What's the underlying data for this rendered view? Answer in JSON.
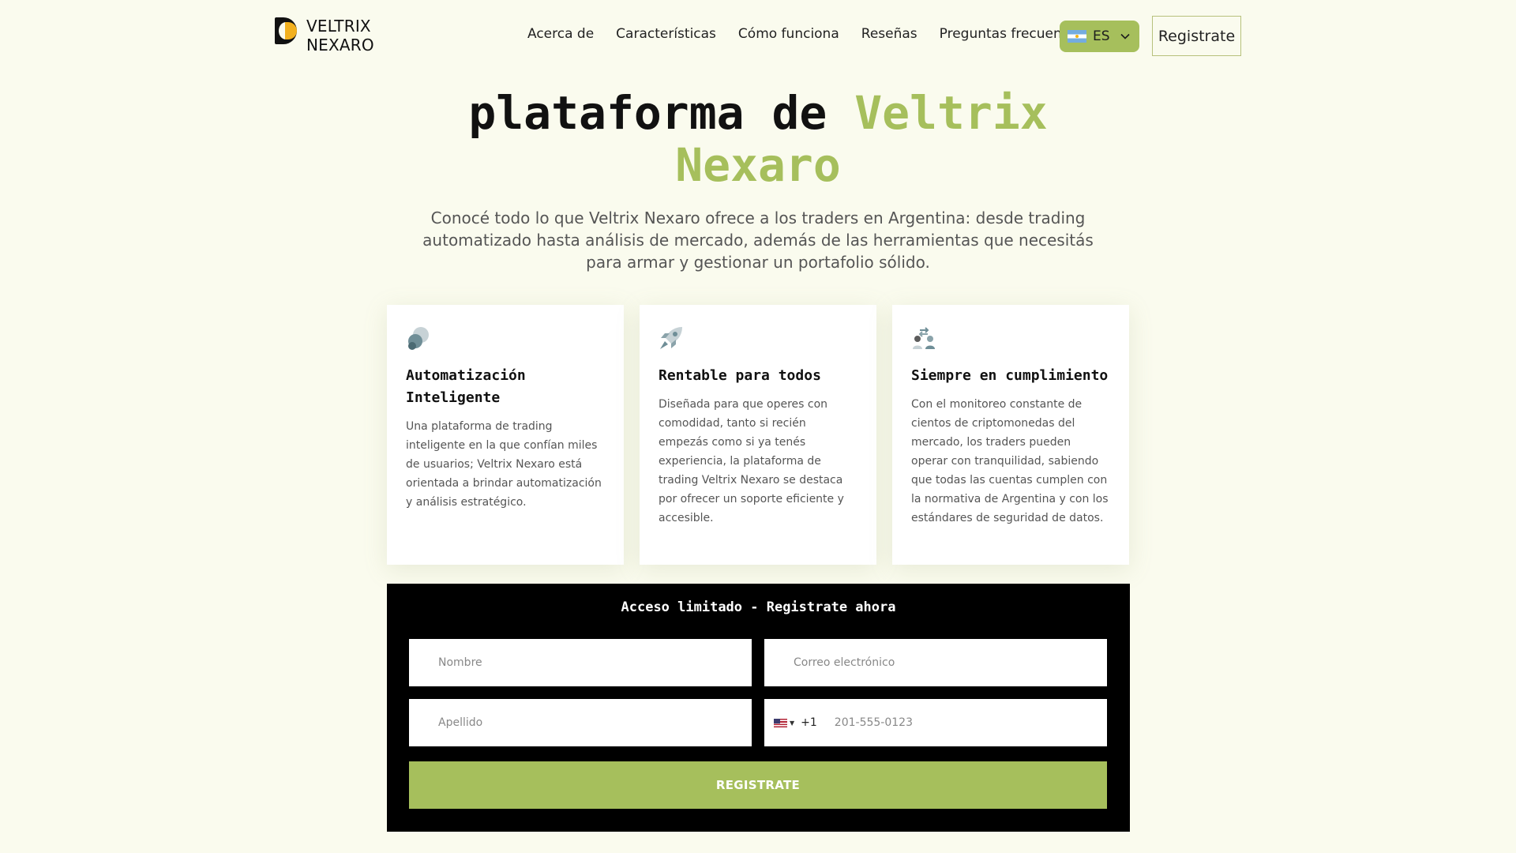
{
  "brand": {
    "line1": "VELTRIX",
    "line2": "NEXARO"
  },
  "nav": {
    "items": [
      {
        "label": "Acerca de"
      },
      {
        "label": "Características"
      },
      {
        "label": "Cómo funciona"
      },
      {
        "label": "Reseñas"
      },
      {
        "label": "Preguntas frecuentes"
      }
    ]
  },
  "lang": {
    "code": "ES",
    "flag_icon": "argentina-flag-icon"
  },
  "header": {
    "register_label": "Registrate"
  },
  "hero": {
    "title_prefix": "plataforma de",
    "title_accent": "Veltrix Nexaro",
    "subtitle": "Conocé todo lo que Veltrix Nexaro ofrece a los traders en Argentina: desde trading automatizado hasta análisis de mercado, además de las herramientas que necesitás para armar y gestionar un portafolio sólido."
  },
  "cards": [
    {
      "icon": "circles-icon",
      "title": "Automatización Inteligente",
      "text": "Una plataforma de trading inteligente en la que confían miles de usuarios; Veltrix Nexaro está orientada a brindar automatización y análisis estratégico."
    },
    {
      "icon": "rocket-icon",
      "title": "Rentable para todos",
      "text": "Diseñada para que operes con comodidad, tanto si recién empezás como si ya tenés experiencia, la plataforma de trading Veltrix Nexaro se destaca por ofrecer un soporte eficiente y accesible."
    },
    {
      "icon": "users-exchange-icon",
      "title": "Siempre en cumplimiento",
      "text": "Con el monitoreo constante de cientos de criptomonedas del mercado, los traders pueden operar con tranquilidad, sabiendo que todas las cuentas cumplen con la normativa de Argentina y con los estándares de seguridad de datos."
    }
  ],
  "form": {
    "title": "Acceso limitado - Registrate ahora",
    "first_name_placeholder": "Nombre",
    "email_placeholder": "Correo electrónico",
    "last_name_placeholder": "Apellido",
    "phone_country_icon": "us-flag-icon",
    "phone_dial_code": "+1",
    "phone_placeholder": "201-555-0123",
    "submit_label": "REGISTRATE"
  },
  "colors": {
    "accent": "#a6bf5c",
    "background": "#fafbee",
    "logo_yellow": "#f2b01e"
  }
}
